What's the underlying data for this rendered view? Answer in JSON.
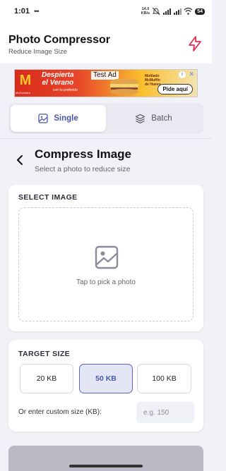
{
  "status_bar": {
    "time": "1:01",
    "notification_dots": "•••",
    "speed_value": "14.0",
    "speed_unit": "KB/s",
    "battery": "54"
  },
  "header": {
    "title": "Photo Compressor",
    "subtitle": "Reduce Image Size",
    "action_icon": "flash-icon",
    "accent_color": "#e0304e"
  },
  "ad": {
    "logo": "M",
    "logo_caption": "McDonald's",
    "headline_line1": "Despierta",
    "headline_line2": "el Verano",
    "headline_sub": "con tu preferido",
    "test_label": "Test Ad",
    "product_line1": "Mutilado",
    "product_line2": "McMuffin",
    "product_line3": "de Huevo",
    "cta": "Pide aquí",
    "info": "i",
    "close": "✕"
  },
  "mode_toggle": {
    "single_label": "Single",
    "batch_label": "Batch"
  },
  "page": {
    "title": "Compress Image",
    "subtitle": "Select a photo to reduce size"
  },
  "select_image": {
    "label": "SELECT IMAGE",
    "prompt": "Tap to pick a photo"
  },
  "target_size": {
    "label": "TARGET SIZE",
    "options": [
      {
        "label": "20 KB"
      },
      {
        "label": "50 KB"
      },
      {
        "label": "100 KB"
      }
    ],
    "selected": "50 KB",
    "custom_label": "Or enter custom size (KB):",
    "custom_placeholder": "e.g. 150",
    "custom_value": ""
  },
  "colors": {
    "primary": "#4a57a3",
    "background": "#f1f2f7"
  }
}
